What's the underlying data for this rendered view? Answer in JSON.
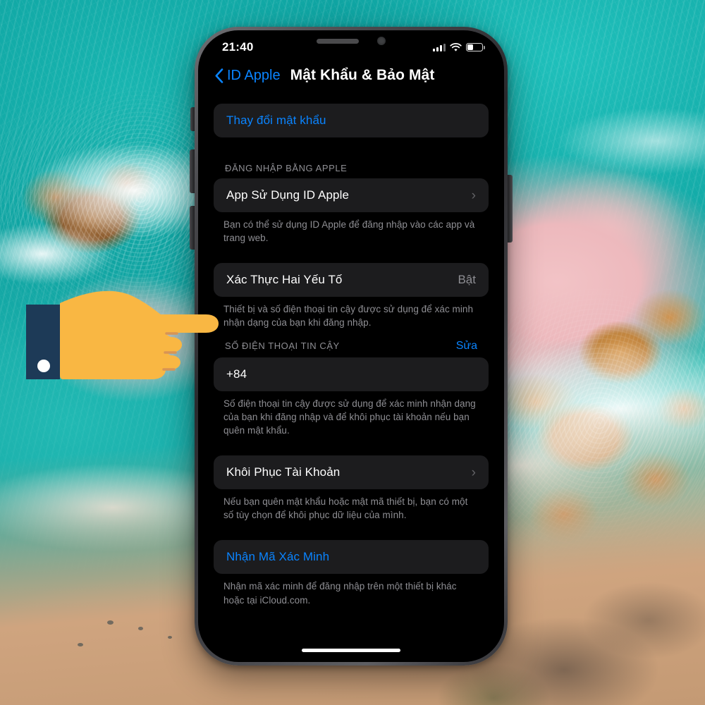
{
  "statusbar": {
    "time": "21:40",
    "signal_icon": "cellular-signal-icon",
    "wifi_icon": "wifi-icon",
    "battery_icon": "battery-icon"
  },
  "navbar": {
    "back_label": "ID Apple",
    "back_icon": "chevron-left-icon",
    "title": "Mật Khẩu & Bảo Mật"
  },
  "content": {
    "change_password": {
      "label": "Thay đổi mật khẩu"
    },
    "signin_section": {
      "header": "ĐĂNG NHẬP BẰNG APPLE",
      "row_label": "App Sử Dụng ID Apple",
      "chevron": "›",
      "footnote": "Bạn có thể sử dụng ID Apple để đăng nhập vào các app và trang web."
    },
    "two_factor": {
      "label": "Xác Thực Hai Yếu Tố",
      "value": "Bật",
      "footnote": "Thiết bị và số điện thoại tin cậy được sử dụng để xác minh nhận dạng của bạn khi đăng nhập."
    },
    "trusted_phone": {
      "header": "SỐ ĐIỆN THOẠI TIN CẬY",
      "action": "Sửa",
      "number": "+84",
      "footnote": "Số điện thoại tin cậy được sử dụng để xác minh nhận dạng của bạn khi đăng nhập và để khôi phục tài khoản nếu bạn quên mật khẩu."
    },
    "account_recovery": {
      "label": "Khôi Phục Tài Khoản",
      "chevron": "›",
      "footnote": "Nếu bạn quên mật khẩu hoặc mật mã thiết bị, bạn có một số tùy chọn để khôi phục dữ liệu của mình."
    },
    "verification_code": {
      "label": "Nhận Mã Xác Minh",
      "footnote": "Nhận mã xác minh để đăng nhập trên một thiết bị khác hoặc tại iCloud.com."
    }
  },
  "overlay": {
    "hand_icon": "pointing-hand-icon"
  },
  "colors": {
    "accent_blue": "#0a84ff",
    "card_bg": "#1c1c1e",
    "secondary_text": "#8e8e93",
    "screen_bg": "#000000",
    "hand_fill": "#f9b743",
    "cuff_fill": "#1d3a57"
  }
}
